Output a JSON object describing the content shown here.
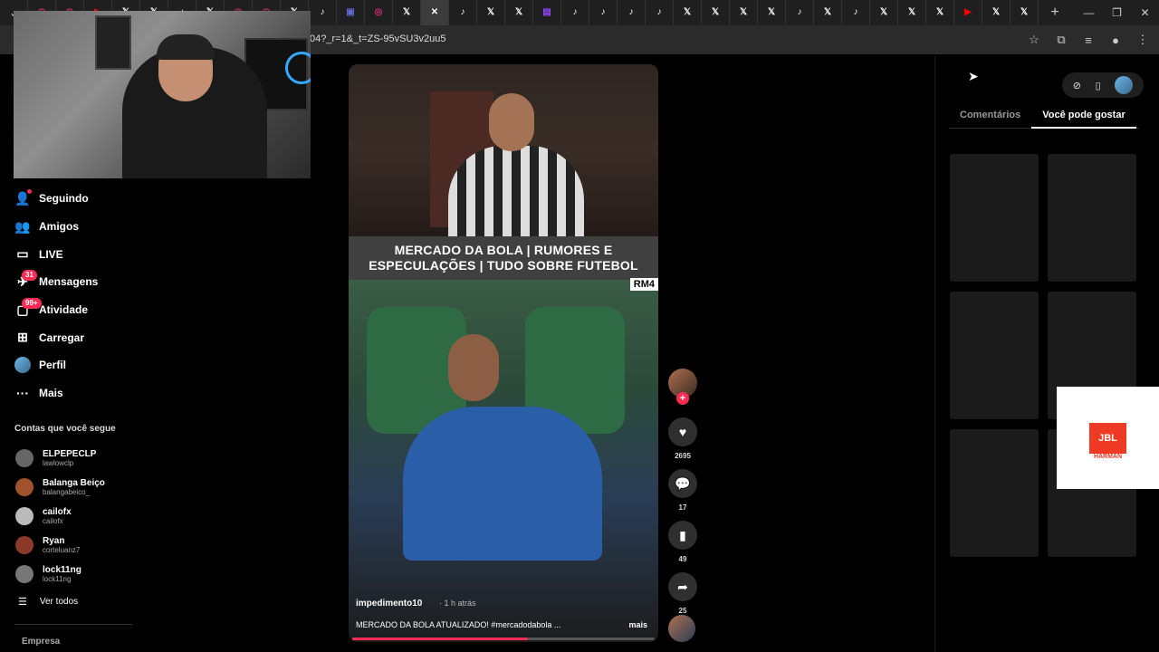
{
  "browser": {
    "tabs": [
      {
        "icon": "instagram-icon",
        "glyph": "◎",
        "color": "#d62976"
      },
      {
        "icon": "instagram-icon",
        "glyph": "◎",
        "color": "#d62976"
      },
      {
        "icon": "youtube-icon",
        "glyph": "▶",
        "color": "#ff0000"
      },
      {
        "icon": "x-icon",
        "glyph": "𝕏",
        "color": "#ffffff"
      },
      {
        "icon": "x-icon",
        "glyph": "𝕏",
        "color": "#ffffff"
      },
      {
        "icon": "tiktok-icon",
        "glyph": "♪",
        "color": "#ffffff"
      },
      {
        "icon": "x-icon",
        "glyph": "𝕏",
        "color": "#ffffff"
      },
      {
        "icon": "instagram-icon",
        "glyph": "◎",
        "color": "#d62976"
      },
      {
        "icon": "instagram-icon",
        "glyph": "◎",
        "color": "#d62976"
      },
      {
        "icon": "x-icon",
        "glyph": "𝕏",
        "color": "#ffffff"
      },
      {
        "icon": "tiktok-icon",
        "glyph": "♪",
        "color": "#ffffff"
      },
      {
        "icon": "app-icon",
        "glyph": "▣",
        "color": "#5b6bd6"
      },
      {
        "icon": "instagram-icon",
        "glyph": "◎",
        "color": "#d62976"
      },
      {
        "icon": "x-icon",
        "glyph": "𝕏",
        "color": "#ffffff"
      },
      {
        "icon": "close-icon",
        "glyph": "✕",
        "color": "#ffffff",
        "active": true
      },
      {
        "icon": "tiktok-icon",
        "glyph": "♪",
        "color": "#ffffff"
      },
      {
        "icon": "x-icon",
        "glyph": "𝕏",
        "color": "#ffffff"
      },
      {
        "icon": "x-icon",
        "glyph": "𝕏",
        "color": "#ffffff"
      },
      {
        "icon": "twitch-icon",
        "glyph": "▤",
        "color": "#9146ff"
      },
      {
        "icon": "tiktok-icon",
        "glyph": "♪",
        "color": "#ffffff"
      },
      {
        "icon": "tiktok-icon",
        "glyph": "♪",
        "color": "#ffffff"
      },
      {
        "icon": "tiktok-icon",
        "glyph": "♪",
        "color": "#ffffff"
      },
      {
        "icon": "tiktok-icon",
        "glyph": "♪",
        "color": "#ffffff"
      },
      {
        "icon": "x-icon",
        "glyph": "𝕏",
        "color": "#ffffff"
      },
      {
        "icon": "x-icon",
        "glyph": "𝕏",
        "color": "#ffffff"
      },
      {
        "icon": "x-icon",
        "glyph": "𝕏",
        "color": "#ffffff"
      },
      {
        "icon": "x-icon",
        "glyph": "𝕏",
        "color": "#ffffff"
      },
      {
        "icon": "tiktok-icon",
        "glyph": "♪",
        "color": "#ffffff"
      },
      {
        "icon": "x-icon",
        "glyph": "𝕏",
        "color": "#ffffff"
      },
      {
        "icon": "tiktok-icon",
        "glyph": "♪",
        "color": "#ffffff"
      },
      {
        "icon": "x-icon",
        "glyph": "𝕏",
        "color": "#ffffff"
      },
      {
        "icon": "x-icon",
        "glyph": "𝕏",
        "color": "#ffffff"
      },
      {
        "icon": "x-icon",
        "glyph": "𝕏",
        "color": "#ffffff"
      },
      {
        "icon": "youtube-icon",
        "glyph": "▶",
        "color": "#ff0000"
      },
      {
        "icon": "x-icon",
        "glyph": "𝕏",
        "color": "#ffffff"
      },
      {
        "icon": "x-icon",
        "glyph": "𝕏",
        "color": "#ffffff"
      }
    ],
    "url_fragment": "04?_r=1&_t=ZS-95vSU3v2uu5"
  },
  "nav": {
    "items": [
      {
        "label": "Seguindo",
        "icon": "following-icon",
        "glyph": "👤"
      },
      {
        "label": "Amigos",
        "icon": "friends-icon",
        "glyph": "👥"
      },
      {
        "label": "LIVE",
        "icon": "live-icon",
        "glyph": "▭"
      },
      {
        "label": "Mensagens",
        "icon": "messages-icon",
        "glyph": "✈",
        "badge": "31"
      },
      {
        "label": "Atividade",
        "icon": "activity-icon",
        "glyph": "▢",
        "badge": "99+"
      },
      {
        "label": "Carregar",
        "icon": "upload-icon",
        "glyph": "⊞"
      },
      {
        "label": "Perfil",
        "icon": "profile-avatar-icon",
        "glyph": ""
      },
      {
        "label": "Mais",
        "icon": "more-icon",
        "glyph": "···"
      }
    ]
  },
  "following": {
    "title": "Contas que você segue",
    "accounts": [
      {
        "name": "ELPEPECLP",
        "handle": "lawlowclp",
        "color": "#666666"
      },
      {
        "name": "Balanga Beiço",
        "handle": "balangabeico_",
        "color": "#a0522d"
      },
      {
        "name": "cailofx",
        "handle": "cailofx",
        "color": "#bbbbbb"
      },
      {
        "name": "Ryan",
        "handle": "corteluanz7",
        "color": "#8b3a2a"
      },
      {
        "name": "lock11ng",
        "handle": "lock11ng",
        "color": "#777777"
      }
    ],
    "see_all": "Ver todos",
    "company": "Empresa"
  },
  "video": {
    "title_line1": "MERCADO DA BOLA | RUMORES E",
    "title_line2": "ESPECULAÇÕES | TUDO SOBRE FUTEBOL",
    "watermark": "RM4",
    "author": "impedimento10",
    "time": "· 1 h atrás",
    "description": "MERCADO DA BOLA ATUALIZADO! #mercadodabola ...",
    "more": "mais",
    "progress": 0.58
  },
  "actions": {
    "likes": "2695",
    "comments": "17",
    "saves": "49",
    "shares": "25"
  },
  "right_panel": {
    "tabs": [
      {
        "label": "Comentários",
        "active": false
      },
      {
        "label": "Você pode gostar",
        "active": true
      }
    ],
    "ad": {
      "brand": "JBL",
      "sub": "HARMAN"
    }
  }
}
